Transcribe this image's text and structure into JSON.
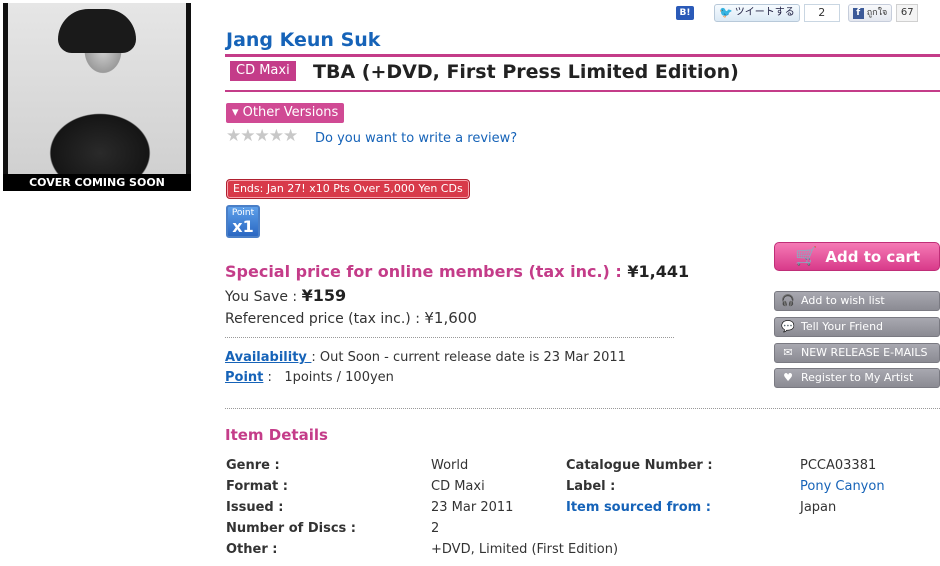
{
  "cover": {
    "caption": "COVER COMING SOON"
  },
  "social": {
    "hatena_label": "B!",
    "tweet_label": "ツイートする",
    "tweet_count": "2",
    "fb_label": "ถูกใจ",
    "fb_count": "67"
  },
  "product": {
    "artist": "Jang Keun Suk",
    "format": "CD Maxi",
    "title": "TBA (+DVD, First Press Limited Edition)",
    "other_versions": "▾ Other Versions",
    "stars": "★★★★★",
    "review_link": "Do you want to write a review?",
    "campaign": "Ends: Jan 27! x10 Pts Over 5,000 Yen CDs",
    "point_badge_top": "Point",
    "point_badge_mult": "x1"
  },
  "price": {
    "special_label": "Special price for online members (tax inc.) : ",
    "special_amount": "¥1,441",
    "save_label": "You Save : ",
    "save_amount": "¥159",
    "ref_label": "Referenced price (tax inc.) : ",
    "ref_amount": "¥1,600"
  },
  "availability": {
    "label": "Availability ",
    "text": ": Out Soon - current release date is 23 Mar 2011",
    "point_label": "Point",
    "point_sep": " : ",
    "point_text": "1points / 100yen"
  },
  "actions": {
    "cart": "Add to cart",
    "wish": "Add to wish list",
    "friend": "Tell Your Friend",
    "newrel": "NEW RELEASE E-MAILS",
    "register": "Register to My Artist"
  },
  "details": {
    "title": "Item Details",
    "genre_label": "Genre :",
    "genre": "World",
    "format_label": "Format :",
    "format": "CD Maxi",
    "issued_label": "Issued :",
    "issued": "23 Mar 2011",
    "discs_label": "Number of Discs :",
    "discs": "2",
    "other_label": "Other :",
    "other": "+DVD, Limited (First Edition)",
    "catalogue_label": "Catalogue Number :",
    "catalogue": "PCCA03381",
    "label_label": "Label :",
    "label": "Pony Canyon",
    "sourced_label": "Item sourced from :",
    "sourced": "Japan"
  }
}
